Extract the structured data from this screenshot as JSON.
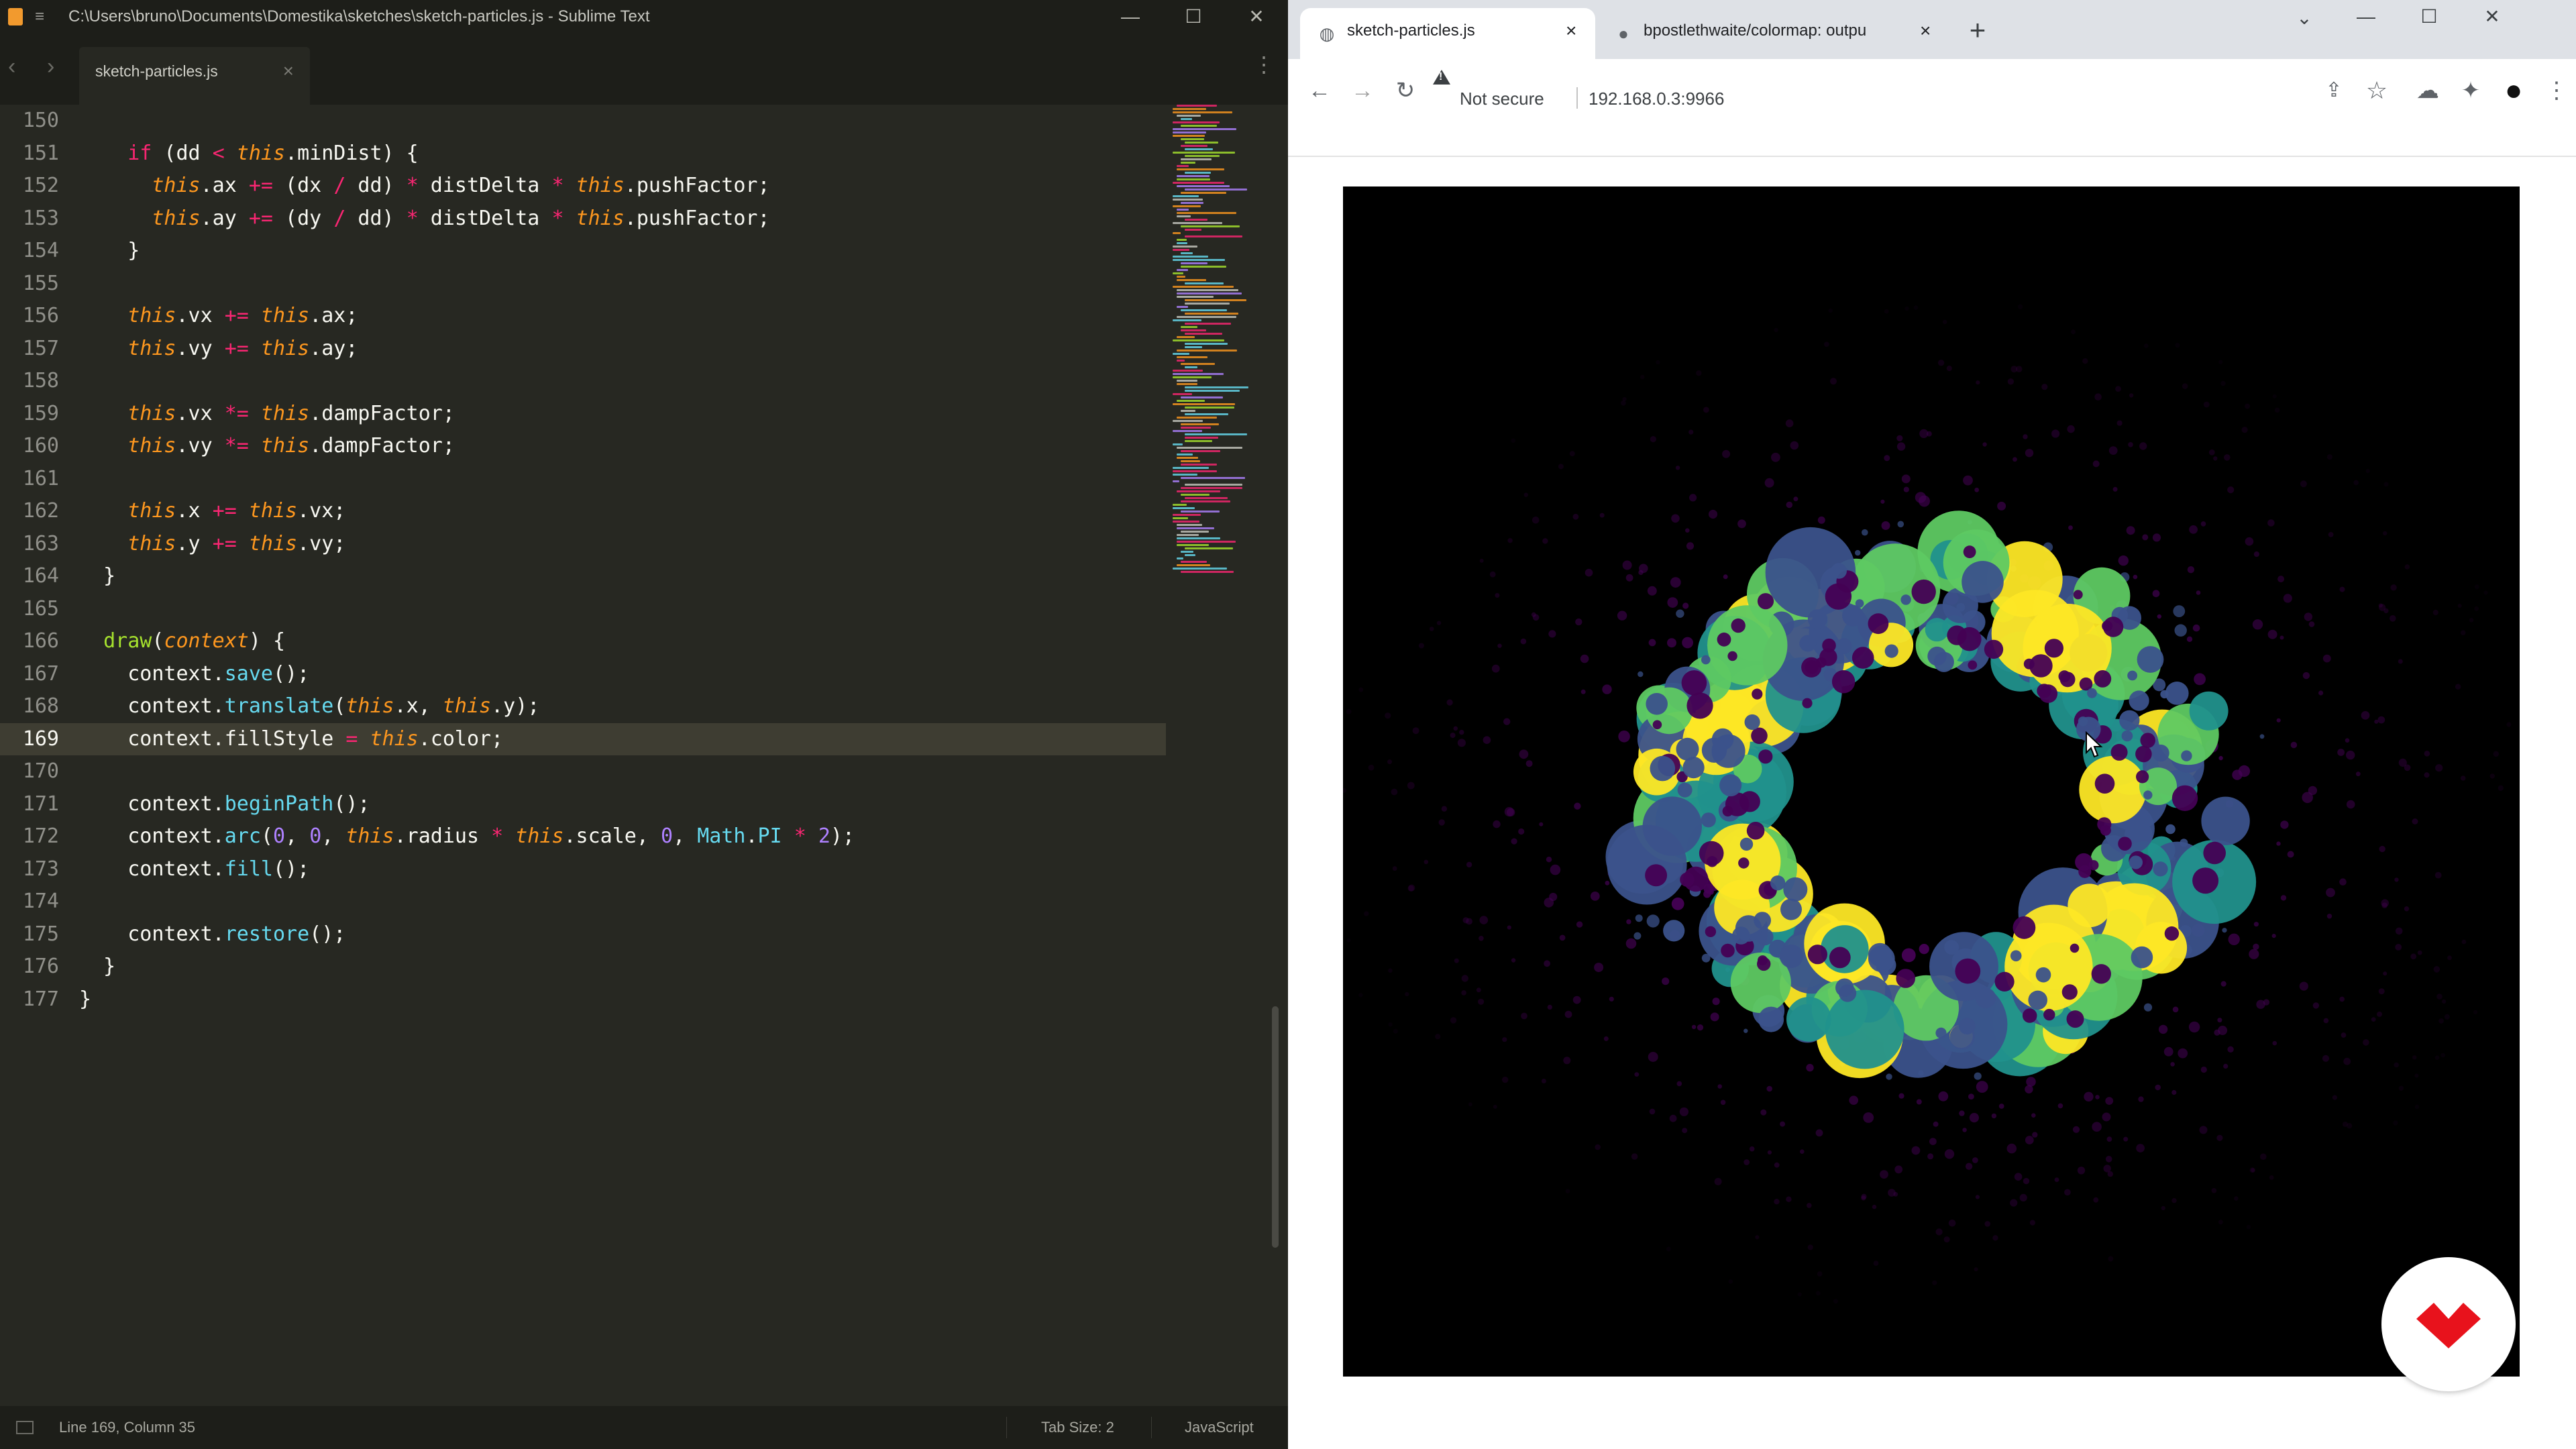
{
  "sublime": {
    "window_title": "C:\\Users\\bruno\\Documents\\Domestika\\sketches\\sketch-particles.js - Sublime Text",
    "tab_label": "sketch-particles.js",
    "tab_close": "×",
    "minimize": "—",
    "maximize": "☐",
    "close": "✕",
    "back": "‹",
    "forward": "›",
    "menu_dots": "⋮",
    "line_numbers": [
      "150",
      "151",
      "152",
      "153",
      "154",
      "155",
      "156",
      "157",
      "158",
      "159",
      "160",
      "161",
      "162",
      "163",
      "164",
      "165",
      "166",
      "167",
      "168",
      "169",
      "170",
      "171",
      "172",
      "173",
      "174",
      "175",
      "176",
      "177"
    ],
    "current_line": "169",
    "status": {
      "position": "Line 169, Column 35",
      "tab_size": "Tab Size: 2",
      "syntax": "JavaScript"
    }
  },
  "chrome": {
    "tabs": [
      {
        "label": "sketch-particles.js",
        "icon": "globe-icon",
        "close": "×"
      },
      {
        "label": "bpostlethwaite/colormap: outpu",
        "icon": "github-icon",
        "close": "×"
      }
    ],
    "new_tab": "+",
    "dropdown": "⌄",
    "minimize": "—",
    "maximize": "☐",
    "close": "✕",
    "nav": {
      "back": "←",
      "forward": "→",
      "reload": "↻"
    },
    "security_text": "Not secure",
    "url": "192.168.0.3:9966",
    "actions": {
      "share": "⇪",
      "star": "☆",
      "cloud": "☁",
      "extensions": "✦",
      "profile": "●",
      "menu": "⋮"
    }
  },
  "colors": {
    "editor_bg": "#272822",
    "keyword": "#f92672",
    "this_keyword": "#fd971f",
    "function": "#a6e22e",
    "builtin": "#66d9ef",
    "number": "#ae81ff",
    "viridis": [
      "#440154",
      "#3b528b",
      "#21918c",
      "#5ec962",
      "#fde725"
    ],
    "domestika_red": "#e8121c"
  }
}
